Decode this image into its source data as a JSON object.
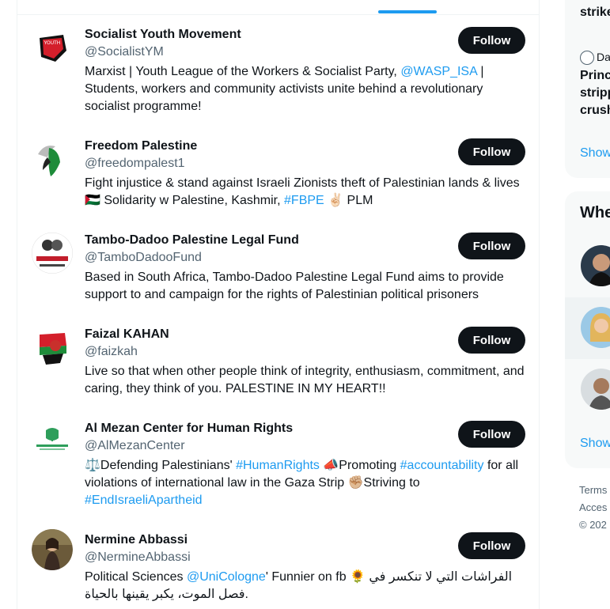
{
  "users": [
    {
      "name": "Socialist Youth Movement",
      "handle": "@SocialistYM",
      "follow_label": "Follow",
      "bio": [
        {
          "text": "Marxist | Youth League of the Workers & Socialist Party, "
        },
        {
          "text": "@WASP_ISA",
          "link": true
        },
        {
          "text": " | Students, workers and community activists unite behind a revolutionary socialist programme!"
        }
      ]
    },
    {
      "name": "Freedom Palestine",
      "handle": "@freedompalest1",
      "follow_label": "Follow",
      "bio": [
        {
          "text": "Fight injustice & stand against Israeli Zionists theft of Palestinian lands & lives 🇵🇸 Solidarity w Palestine, Kashmir, "
        },
        {
          "text": "#FBPE",
          "link": true
        },
        {
          "text": " ✌🏻 PLM"
        }
      ]
    },
    {
      "name": "Tambo-Dadoo Palestine Legal Fund",
      "handle": "@TamboDadooFund",
      "follow_label": "Follow",
      "bio": [
        {
          "text": "Based in South Africa, Tambo-Dadoo Palestine Legal Fund aims to provide support to and campaign for the rights of Palestinian political prisoners"
        }
      ]
    },
    {
      "name": "Faizal KAHAN",
      "handle": "@faizkah",
      "follow_label": "Follow",
      "bio": [
        {
          "text": "Live so that when other people think of integrity, enthusiasm, commitment, and caring, they think of you. PALESTINE IN MY HEART!!"
        }
      ]
    },
    {
      "name": "Al Mezan Center for Human Rights",
      "handle": "@AlMezanCenter",
      "follow_label": "Follow",
      "bio": [
        {
          "text": "⚖️Defending Palestinians' "
        },
        {
          "text": "#HumanRights",
          "link": true
        },
        {
          "text": " 📣Promoting "
        },
        {
          "text": "#accountability",
          "link": true
        },
        {
          "text": " for all violations of international law in the Gaza Strip ✊🏼Striving to "
        },
        {
          "text": "#EndIsraeliApartheid",
          "link": true
        }
      ]
    },
    {
      "name": "Nermine Abbassi",
      "handle": "@NermineAbbassi",
      "follow_label": "Follow",
      "bio": [
        {
          "text": "Political Sciences "
        },
        {
          "text": "@UniCologne",
          "link": true
        },
        {
          "text": "' Funnier on fb 🌻 الفراشات التي لا تنكسر في فصل الموت، يكبر يقينها بالحياة."
        }
      ]
    }
  ],
  "sidebar": {
    "trend_line_1": "strike",
    "trend_author_fragment": "Da",
    "trend_headline": [
      "Princ",
      "stripp",
      "crush"
    ],
    "trend_show": "Show",
    "wtf_title": "Whe",
    "wtf_show": "Show",
    "footer": [
      "Terms",
      "Acces",
      "© 202"
    ]
  },
  "colors": {
    "accent": "#1d9bf0",
    "button_bg": "#0f1419",
    "secondary_text": "#536471"
  }
}
